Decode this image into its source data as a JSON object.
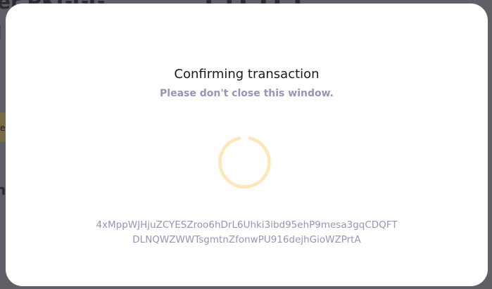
{
  "modal": {
    "title": "Confirming transaction",
    "subtitle": "Please don't close this window.",
    "transaction_hash_line1": "4xMppWJHjuZCYESZroo6hDrL6Uhki3ibd95ehP9mesa3gqCDQFT",
    "transaction_hash_line2": "DLNQWZWWTsgmtnZfonwPU916dejhGioWZPrtA"
  },
  "spinner": {
    "icon": "loading-spinner-icon",
    "color": "#fde6b8"
  },
  "colors": {
    "backdrop": "#5f6066",
    "modal_background": "#ffffff",
    "title_text": "#1a1a1f",
    "muted_text": "#9a92b8"
  }
}
